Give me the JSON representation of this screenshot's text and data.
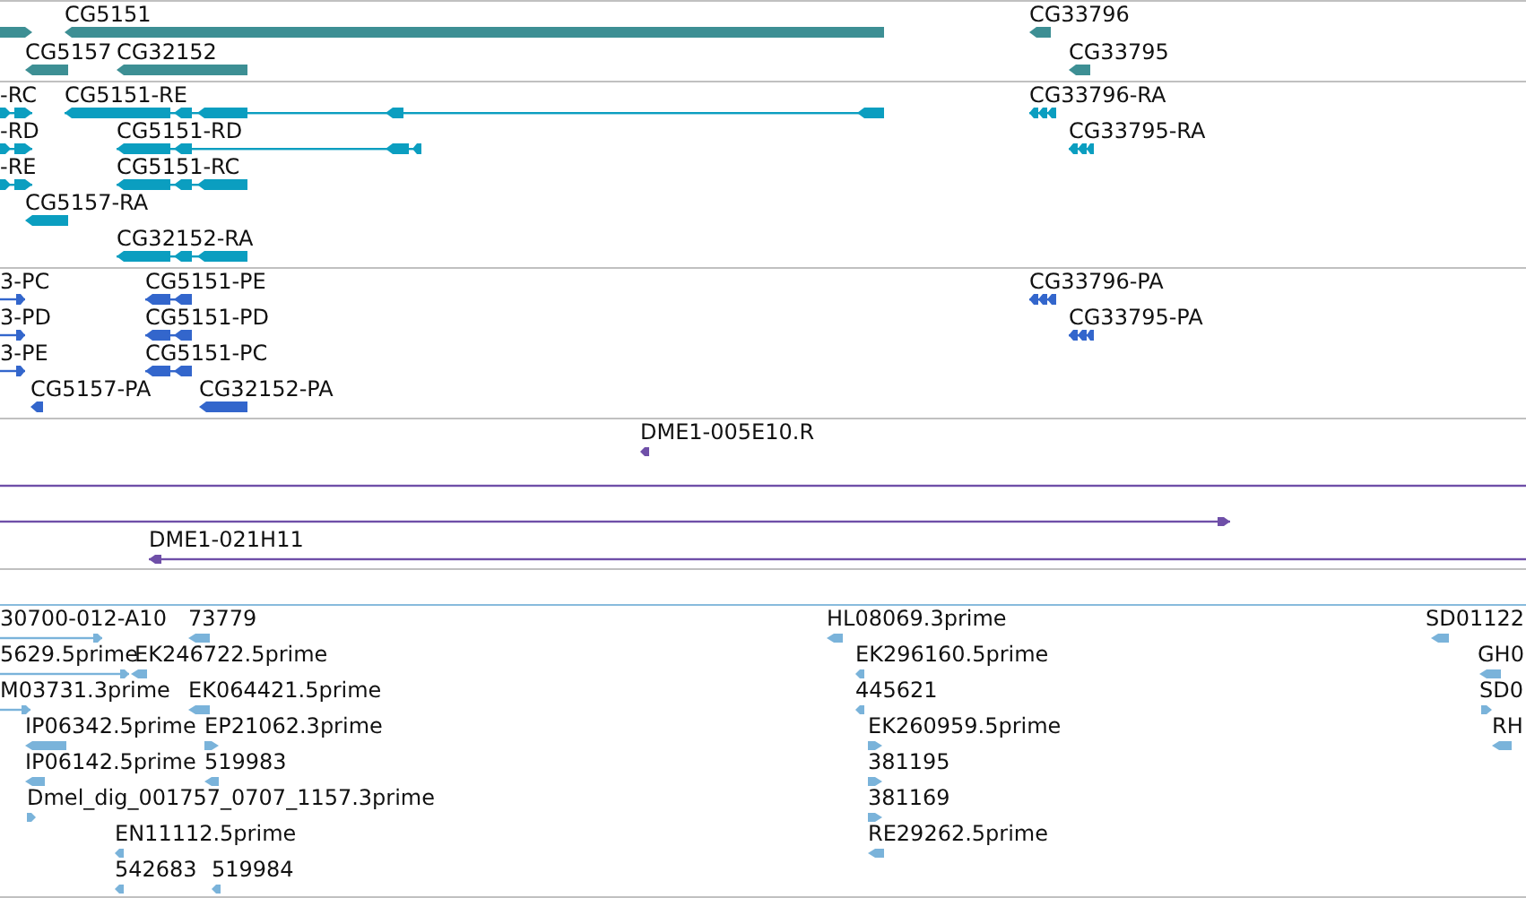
{
  "tracks": [
    {
      "kind": "gene",
      "color": "#3d8f94",
      "features": [
        {
          "reverse": false
        },
        {
          "label": "CG5151",
          "reverse": true
        },
        {
          "label": "CG5157",
          "reverse": true
        },
        {
          "label": "CG32152",
          "reverse": true
        },
        {
          "label": "CG33796",
          "reverse": true
        },
        {
          "label": "CG33795",
          "reverse": true
        }
      ]
    },
    {
      "kind": "transcript",
      "color": "#0b9ec0",
      "features": [
        {
          "label": "-RC",
          "reverse": false
        },
        {
          "label": "CG5151-RE",
          "reverse": true
        },
        {
          "label": "-RD",
          "reverse": false
        },
        {
          "label": "CG5151-RD",
          "reverse": true
        },
        {
          "label": "-RE",
          "reverse": false
        },
        {
          "label": "CG5151-RC",
          "reverse": true
        },
        {
          "label": "CG5157-RA",
          "reverse": true
        },
        {
          "label": "CG32152-RA",
          "reverse": true
        },
        {
          "label": "CG33796-RA",
          "reverse": true
        },
        {
          "label": "CG33795-RA",
          "reverse": true
        }
      ]
    },
    {
      "kind": "protein",
      "color": "#3366cc",
      "features": [
        {
          "label": "3-PC",
          "reverse": false
        },
        {
          "label": "CG5151-PE",
          "reverse": true
        },
        {
          "label": "3-PD",
          "reverse": false
        },
        {
          "label": "CG5151-PD",
          "reverse": true
        },
        {
          "label": "3-PE",
          "reverse": false
        },
        {
          "label": "CG5151-PC",
          "reverse": true
        },
        {
          "label": "CG5157-PA",
          "reverse": true
        },
        {
          "label": "CG32152-PA",
          "reverse": true
        },
        {
          "label": "CG33796-PA",
          "reverse": true
        },
        {
          "label": "CG33795-PA",
          "reverse": true
        }
      ]
    },
    {
      "kind": "clone",
      "color": "#6f4fa8",
      "features": [
        {
          "label": "DME1-005E10.R",
          "reverse": true
        },
        {
          "reverse": false
        },
        {
          "reverse": false
        },
        {
          "label": "DME1-021H11",
          "reverse": true
        }
      ]
    },
    {
      "kind": "est",
      "color": "#7ab3da",
      "features": [
        {
          "label": "30700-012-A10",
          "reverse": false
        },
        {
          "label": "73779",
          "reverse": true
        },
        {
          "label": "5629.5prime",
          "reverse": false
        },
        {
          "label": "EK246722.5prime",
          "reverse": true
        },
        {
          "label": "M03731.3prime",
          "reverse": false
        },
        {
          "label": "EK064421.5prime",
          "reverse": true
        },
        {
          "label": "IP06342.5prime",
          "reverse": true
        },
        {
          "label": "EP21062.3prime",
          "reverse": false
        },
        {
          "label": "IP06142.5prime",
          "reverse": true
        },
        {
          "label": "519983",
          "reverse": true
        },
        {
          "label": "Dmel_dig_001757_0707_1157.3prime",
          "reverse": false
        },
        {
          "label": "EN11112.5prime",
          "reverse": true
        },
        {
          "label": "542683",
          "reverse": true
        },
        {
          "label": "519984",
          "reverse": true
        },
        {
          "label": "HL08069.3prime",
          "reverse": true
        },
        {
          "label": "EK296160.5prime",
          "reverse": true
        },
        {
          "label": "445621",
          "reverse": true
        },
        {
          "label": "EK260959.5prime",
          "reverse": false
        },
        {
          "label": "381195",
          "reverse": false
        },
        {
          "label": "381169",
          "reverse": false
        },
        {
          "label": "RE29262.5prime",
          "reverse": true
        },
        {
          "label": "SD01122",
          "reverse": true
        },
        {
          "label": "GH0",
          "reverse": true
        },
        {
          "label": "SD0",
          "reverse": false
        },
        {
          "label": "RH",
          "reverse": true
        }
      ]
    }
  ]
}
